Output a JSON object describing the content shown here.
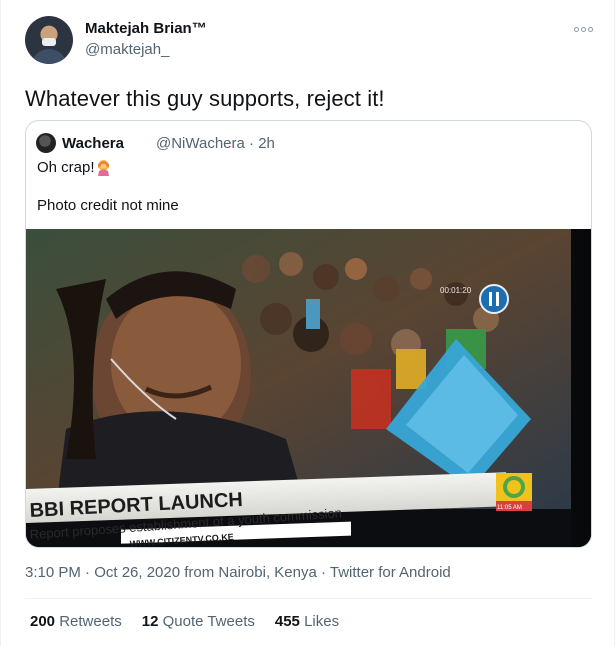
{
  "author": {
    "name": "Maktejah Brian™",
    "handle": "@maktejah_"
  },
  "tweet": {
    "text": "Whatever this guy supports, reject it!"
  },
  "quoted": {
    "name": "Wachera",
    "handle_time": "@NiWachera · 2h",
    "line1": "Oh crap!",
    "emoji": "woman-facepalming-icon",
    "line2": "Photo credit not mine",
    "media": {
      "headline": "BBI REPORT LAUNCH",
      "subline": "Report proposes establishment of a youth commission",
      "url": "WWW.CITIZENTV.CO.KE",
      "clock": "00:01:20",
      "time": "11:05 AM"
    }
  },
  "meta": {
    "text": "3:10 PM · Oct 26, 2020 from Nairobi, Kenya · Twitter for Android"
  },
  "stats": [
    {
      "count": "200",
      "label": "Retweets"
    },
    {
      "count": "12",
      "label": "Quote Tweets"
    },
    {
      "count": "455",
      "label": "Likes"
    }
  ]
}
